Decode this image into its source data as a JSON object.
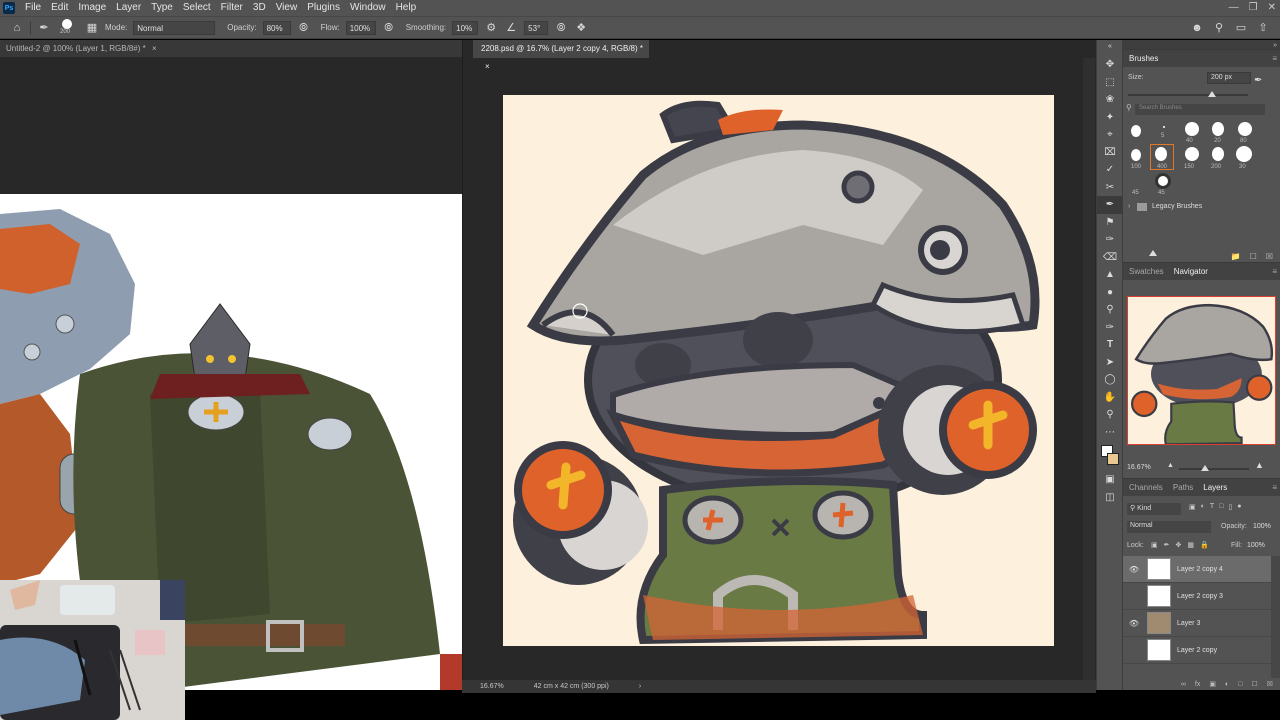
{
  "app": {
    "logo": "Ps"
  },
  "menu": [
    "File",
    "Edit",
    "Image",
    "Layer",
    "Type",
    "Select",
    "Filter",
    "3D",
    "View",
    "Plugins",
    "Window",
    "Help"
  ],
  "options": {
    "brush_size": "200",
    "mode_label": "Mode:",
    "mode_value": "Normal",
    "opacity_label": "Opacity:",
    "opacity_value": "80%",
    "flow_label": "Flow:",
    "flow_value": "100%",
    "smoothing_label": "Smoothing:",
    "smoothing_value": "10%",
    "angle_value": "53°"
  },
  "documents": {
    "left_tab": "Untitled-2 @ 100% (Layer 1, RGB/8#) *",
    "right_tab": "2208.psd @ 16.7% (Layer 2 copy 4, RGB/8) *",
    "status_zoom": "16.67%",
    "status_size": "42 cm x 42 cm (300 ppi)"
  },
  "brushes": {
    "title": "Brushes",
    "size_label": "Size:",
    "size_value": "200 px",
    "search_placeholder": "Search Brushes",
    "presets_row1": [
      "",
      "5",
      "40",
      "20",
      "80"
    ],
    "presets_row2": [
      "100",
      "400",
      "150",
      "200",
      "30"
    ],
    "presets_row3": [
      "45",
      "45"
    ],
    "legacy_label": "Legacy Brushes"
  },
  "navigator": {
    "tabs": [
      "Swatches",
      "Navigator"
    ],
    "zoom": "16.67%"
  },
  "layers": {
    "tabs": [
      "Channels",
      "Paths",
      "Layers"
    ],
    "filter_kind": "Kind",
    "blend_mode": "Normal",
    "opacity_label": "Opacity:",
    "opacity_value": "100%",
    "lock_label": "Lock:",
    "fill_label": "Fill:",
    "fill_value": "100%",
    "items": [
      {
        "name": "Layer 2 copy 4",
        "visible": true,
        "active": true
      },
      {
        "name": "Layer 2 copy 3",
        "visible": false,
        "active": false
      },
      {
        "name": "Layer 3",
        "visible": true,
        "active": false
      },
      {
        "name": "Layer 2 copy",
        "visible": false,
        "active": false
      }
    ]
  },
  "colors": {
    "chrome": "#535353",
    "canvas_bg": "#fdf0dc",
    "accent_orange": "#e0622b",
    "outline": "#3a3b45"
  }
}
